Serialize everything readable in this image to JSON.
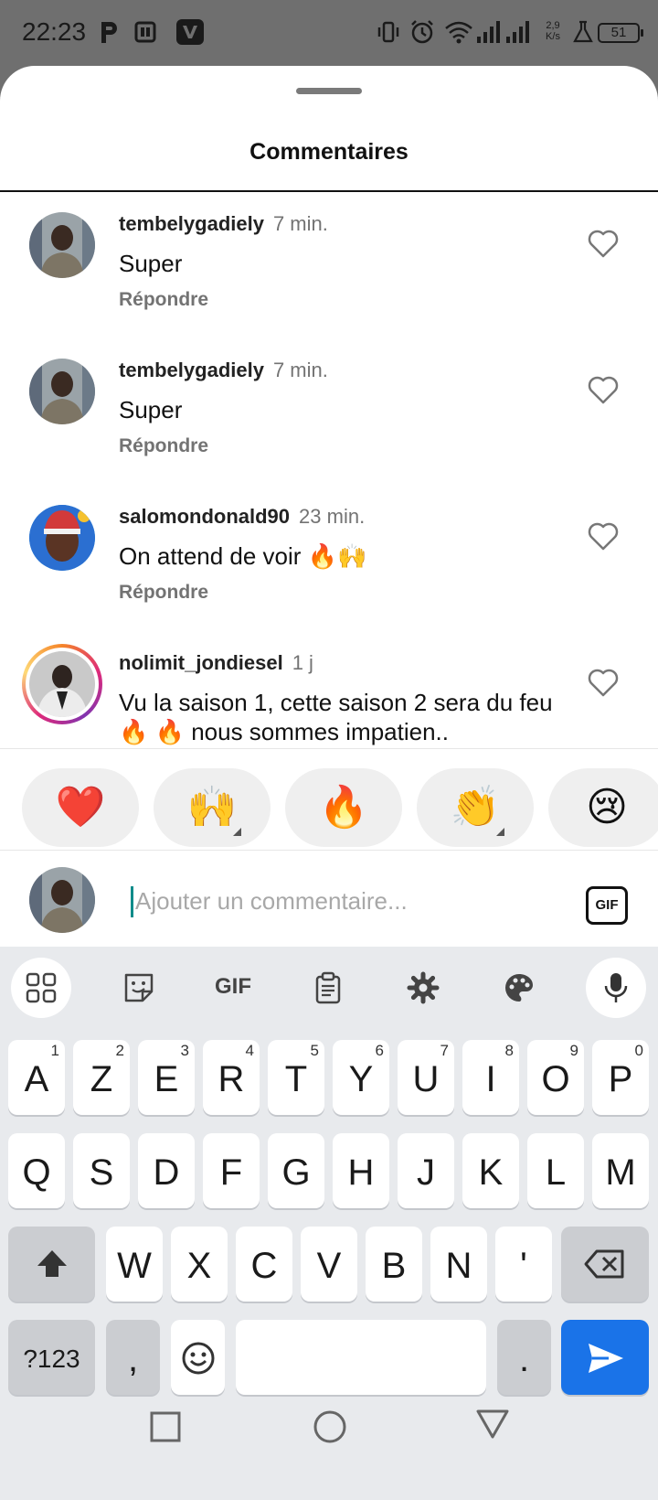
{
  "status_bar": {
    "time": "22:23",
    "speed_value": "2,9",
    "speed_unit": "K/s",
    "battery": "51"
  },
  "sheet": {
    "title": "Commentaires"
  },
  "comments": [
    {
      "user": "tembelygadiely",
      "time": "7 min.",
      "text": "Super",
      "reply": "Répondre"
    },
    {
      "user": "tembelygadiely",
      "time": "7 min.",
      "text": "Super",
      "reply": "Répondre"
    },
    {
      "user": "salomondonald90",
      "time": "23 min.",
      "text": "On attend de voir 🔥🙌",
      "reply": "Répondre"
    },
    {
      "user": "nolimit_jondiesel",
      "time": "1 j",
      "text": "Vu la saison 1, cette saison 2 sera du feu 🔥 🔥 nous sommes impatien..",
      "reply": ""
    }
  ],
  "reactions": [
    "❤️",
    "🙌",
    "🔥",
    "👏",
    "😢"
  ],
  "composer": {
    "placeholder": "Ajouter un commentaire...",
    "gif_label": "GIF"
  },
  "keyboard": {
    "toolbar_gif": "GIF",
    "row1": [
      {
        "k": "A",
        "n": "1"
      },
      {
        "k": "Z",
        "n": "2"
      },
      {
        "k": "E",
        "n": "3"
      },
      {
        "k": "R",
        "n": "4"
      },
      {
        "k": "T",
        "n": "5"
      },
      {
        "k": "Y",
        "n": "6"
      },
      {
        "k": "U",
        "n": "7"
      },
      {
        "k": "I",
        "n": "8"
      },
      {
        "k": "O",
        "n": "9"
      },
      {
        "k": "P",
        "n": "0"
      }
    ],
    "row2": [
      "Q",
      "S",
      "D",
      "F",
      "G",
      "H",
      "J",
      "K",
      "L",
      "M"
    ],
    "row3": [
      "W",
      "X",
      "C",
      "V",
      "B",
      "N",
      "'"
    ],
    "symbols_label": "?123",
    "comma": ",",
    "period": "."
  },
  "icons": {
    "heart": "heart-outline-icon",
    "send": "send-icon",
    "shift": "shift-icon",
    "backspace": "backspace-icon",
    "emoji": "emoji-icon",
    "mic": "microphone-icon"
  },
  "colors": {
    "accent_blue": "#1a73e8",
    "cursor": "#0a8c8a",
    "muted_text": "#737373"
  }
}
